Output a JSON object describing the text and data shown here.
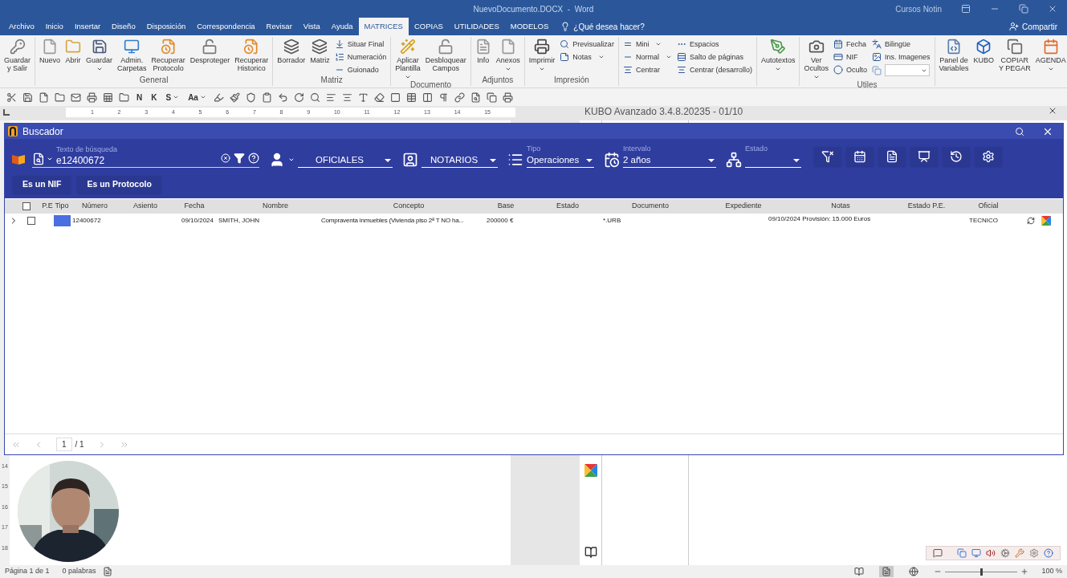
{
  "window": {
    "title": "NuevoDocumento.DOCX  -  Word",
    "user": "Cursos Notin"
  },
  "menu_tabs": [
    {
      "label": "Archivo",
      "selected": false
    },
    {
      "label": "Inicio",
      "selected": false
    },
    {
      "label": "Insertar",
      "selected": false
    },
    {
      "label": "Diseño",
      "selected": false
    },
    {
      "label": "Disposición",
      "selected": false
    },
    {
      "label": "Correspondencia",
      "selected": false
    },
    {
      "label": "Revisar",
      "selected": false
    },
    {
      "label": "Vista",
      "selected": false
    },
    {
      "label": "Ayuda",
      "selected": false
    },
    {
      "label": "MATRICES",
      "selected": true
    },
    {
      "label": "COPIAS",
      "selected": false
    },
    {
      "label": "UTILIDADES",
      "selected": false
    },
    {
      "label": "MODELOS",
      "selected": false
    }
  ],
  "tell_me": "¿Qué desea hacer?",
  "share": "Compartir",
  "ribbon_groups": [
    {
      "items": [
        {
          "kind": "large",
          "lines": [
            "Guardar",
            "y Salir"
          ],
          "dropdown": false
        }
      ]
    },
    {
      "label": "General",
      "items": [
        {
          "kind": "large",
          "lines": [
            "Nuevo"
          ],
          "dropdown": false
        },
        {
          "kind": "large",
          "lines": [
            "Abrir"
          ],
          "dropdown": false
        },
        {
          "kind": "large",
          "lines": [
            "Guardar"
          ],
          "dropdown": true
        },
        {
          "kind": "large",
          "lines": [
            "Admin.",
            "Carpetas"
          ],
          "dropdown": false
        },
        {
          "kind": "large",
          "lines": [
            "Recuperar",
            "Protocolo"
          ],
          "dropdown": false
        },
        {
          "kind": "large",
          "lines": [
            "Desproteger"
          ],
          "dropdown": false
        },
        {
          "kind": "large",
          "lines": [
            "Recuperar",
            "Historico"
          ],
          "dropdown": false
        }
      ]
    },
    {
      "label": "Matriz",
      "items": [
        {
          "kind": "large",
          "lines": [
            "Borrador"
          ],
          "dropdown": false
        },
        {
          "kind": "large",
          "lines": [
            "Matriz"
          ],
          "dropdown": false
        },
        {
          "kind": "column",
          "items": [
            {
              "kind": "small",
              "text": "Situar Final",
              "dropdown": false
            },
            {
              "kind": "small",
              "text": "Numeración",
              "dropdown": false
            },
            {
              "kind": "small",
              "text": "Guionado",
              "dropdown": false
            }
          ]
        }
      ]
    },
    {
      "label": "Documento",
      "items": [
        {
          "kind": "large",
          "lines": [
            "Aplicar",
            "Plantilla"
          ],
          "dropdown": true
        },
        {
          "kind": "large",
          "lines": [
            "Desbloquear",
            "Campos"
          ],
          "dropdown": false
        }
      ]
    },
    {
      "label": "Adjuntos",
      "items": [
        {
          "kind": "large",
          "lines": [
            "Info"
          ],
          "dropdown": false
        },
        {
          "kind": "large",
          "lines": [
            "Anexos"
          ],
          "dropdown": true
        }
      ]
    },
    {
      "label": "Impresión",
      "items": [
        {
          "kind": "large",
          "lines": [
            "Imprimir"
          ],
          "dropdown": true
        },
        {
          "kind": "column",
          "items": [
            {
              "kind": "small",
              "text": "Previsualizar",
              "dropdown": false
            },
            {
              "kind": "small",
              "text": "Notas",
              "dropdown": true
            }
          ]
        }
      ]
    },
    {
      "items": [
        {
          "kind": "column",
          "items": [
            {
              "kind": "small",
              "text": "Mini",
              "dropdown": true
            },
            {
              "kind": "small",
              "text": "Normal",
              "dropdown": true
            },
            {
              "kind": "small",
              "text": "Centrar",
              "dropdown": false
            }
          ]
        },
        {
          "kind": "column",
          "items": [
            {
              "kind": "small",
              "text": "Espacios",
              "dropdown": false
            },
            {
              "kind": "small",
              "text": "Salto de páginas",
              "dropdown": false
            },
            {
              "kind": "small",
              "text": "Centrar (desarrollo)",
              "dropdown": false
            }
          ]
        }
      ]
    },
    {
      "items": [
        {
          "kind": "large",
          "lines": [
            "Autotextos"
          ],
          "dropdown": true
        }
      ]
    },
    {
      "label": "Utiles",
      "items": [
        {
          "kind": "large",
          "lines": [
            "Ver",
            "Ocultos"
          ],
          "dropdown": true
        },
        {
          "kind": "column",
          "items": [
            {
              "kind": "small",
              "text": "Fecha",
              "dropdown": false
            },
            {
              "kind": "small",
              "text": "NIF",
              "dropdown": false
            },
            {
              "kind": "small",
              "text": "Oculto",
              "dropdown": false
            }
          ]
        },
        {
          "kind": "column",
          "items": [
            {
              "kind": "small",
              "text": "Bilingüe",
              "dropdown": false
            },
            {
              "kind": "small",
              "text": "Ins. Imagenes",
              "dropdown": false
            },
            {
              "kind": "combo"
            }
          ]
        }
      ]
    },
    {
      "items": [
        {
          "kind": "large",
          "lines": [
            "Panel de",
            "Variables"
          ],
          "dropdown": false
        },
        {
          "kind": "large",
          "lines": [
            "KUBO"
          ],
          "dropdown": false
        },
        {
          "kind": "large",
          "lines": [
            "COPIAR",
            "Y PEGAR"
          ],
          "dropdown": false
        },
        {
          "kind": "large",
          "lines": [
            "AGENDA"
          ],
          "dropdown": true
        }
      ]
    }
  ],
  "format_letters": [
    "N",
    "K",
    "S",
    "Aa"
  ],
  "ruler_marks": [
    "1",
    "2",
    "3",
    "4",
    "5",
    "6",
    "7",
    "8",
    "9",
    "10",
    "11",
    "12",
    "13",
    "14",
    "15"
  ],
  "side_panel": {
    "title": "KUBO Avanzado 3.4.8.20235 - 01/10"
  },
  "buscador": {
    "title": "Buscador",
    "search": {
      "label": "Texto de búsqueda",
      "value": "e12400672",
      "focused": true
    },
    "filters": [
      {
        "value": "OFICIALES"
      },
      {
        "value": "NOTARIOS"
      },
      {
        "label": "Tipo",
        "value": "Operaciones"
      },
      {
        "label": "Intervalo",
        "value": "2 años"
      },
      {
        "label": "Estado"
      }
    ],
    "quick_buttons": [
      "Es un NIF",
      "Es un Protocolo"
    ],
    "select_all": false,
    "columns": [
      "P.E",
      "Tipo",
      "Número",
      "Asiento",
      "Fecha",
      "Nombre",
      "Concepto",
      "Base",
      "Estado",
      "Documento",
      "Expediente",
      "Notas",
      "Estado P.E.",
      "Oficial"
    ],
    "rows": [
      {
        "expanded": false,
        "checked": false,
        "color": "#4a6fe0",
        "numero": "12400672",
        "fecha": "09/10/2024",
        "nombre": "SMITH, JOHN",
        "concepto": "Compraventa inmuebles (Vivienda piso 2ª T NO ha...",
        "base": "200000 €",
        "documento": "*.URB",
        "notas": "09/10/2024 Provisión: 15.000 Euros",
        "oficial": "TECNICO"
      }
    ],
    "pager": {
      "page": "1",
      "total": "/ 1"
    }
  },
  "vertical_ruler": [
    "14",
    "15",
    "16",
    "17",
    "18"
  ],
  "status_bar": {
    "page": "Página 1 de 1",
    "words": "0 palabras",
    "views": [
      {
        "selected": false
      },
      {
        "selected": true
      },
      {
        "selected": false
      }
    ],
    "zoom": {
      "level": 0.5,
      "reading": "100 %"
    }
  }
}
